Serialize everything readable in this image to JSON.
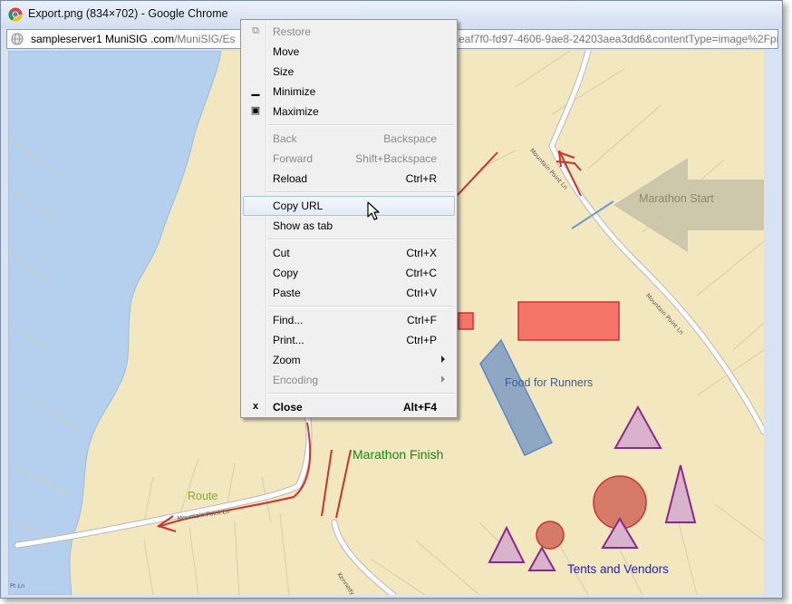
{
  "window": {
    "title": "Export.png (834×702) - Google Chrome",
    "icon": "chrome-icon"
  },
  "address_bar": {
    "icon": "globe-icon",
    "url_host_1": "sampleserver1",
    "url_host_2": "MuniSIG",
    "url_host_3": ".com",
    "url_path_start": "/MuniSIG/Es",
    "url_path_end": "eaf7f0-fd97-4606-9ae8-24203aea3dd6&contentType=image%2Fpm"
  },
  "map": {
    "labels": {
      "marathon_start": "Marathon Start",
      "food_for_runners": "Food for Runners",
      "marathon_finish": "Marathon Finish",
      "route": "Route",
      "tents_and_vendors": "Tents and Vendors"
    },
    "road_labels": {
      "mountain_point_ln_upper": "Mountain Point Ln",
      "mountain_point_ln_right": "Mountain Point Ln",
      "mountain_point_ln_lower": "Mountain Point Ln",
      "kennedy_rd": "Kennedy Rd",
      "pt_ln": "Pt Ln"
    },
    "colors": {
      "land": "#f2e7bf",
      "water": "#b4d0ee",
      "route": "#cc3333",
      "arrow": "#b8b29a",
      "food_area": "#8aa3c4",
      "tent": "#d9b3cc",
      "tent_outline": "#8a2a8a",
      "vendor_area": "#f47468"
    }
  },
  "context_menu": {
    "items": [
      {
        "label": "Restore",
        "shortcut": "",
        "disabled": true,
        "icon": "restore-icon"
      },
      {
        "label": "Move",
        "shortcut": "",
        "disabled": false,
        "icon": ""
      },
      {
        "label": "Size",
        "shortcut": "",
        "disabled": false,
        "icon": ""
      },
      {
        "label": "Minimize",
        "shortcut": "",
        "disabled": false,
        "icon": "minimize-icon"
      },
      {
        "label": "Maximize",
        "shortcut": "",
        "disabled": false,
        "icon": "maximize-icon"
      },
      {
        "label": "Back",
        "shortcut": "Backspace",
        "disabled": true,
        "icon": ""
      },
      {
        "label": "Forward",
        "shortcut": "Shift+Backspace",
        "disabled": true,
        "icon": ""
      },
      {
        "label": "Reload",
        "shortcut": "Ctrl+R",
        "disabled": false,
        "icon": ""
      },
      {
        "label": "Copy URL",
        "shortcut": "",
        "disabled": false,
        "icon": "",
        "highlighted": true
      },
      {
        "label": "Show as tab",
        "shortcut": "",
        "disabled": false,
        "icon": ""
      },
      {
        "label": "Cut",
        "shortcut": "Ctrl+X",
        "disabled": false,
        "icon": ""
      },
      {
        "label": "Copy",
        "shortcut": "Ctrl+C",
        "disabled": false,
        "icon": ""
      },
      {
        "label": "Paste",
        "shortcut": "Ctrl+V",
        "disabled": false,
        "icon": ""
      },
      {
        "label": "Find...",
        "shortcut": "Ctrl+F",
        "disabled": false,
        "icon": ""
      },
      {
        "label": "Print...",
        "shortcut": "Ctrl+P",
        "disabled": false,
        "icon": ""
      },
      {
        "label": "Zoom",
        "shortcut": "",
        "disabled": false,
        "icon": "",
        "submenu": true
      },
      {
        "label": "Encoding",
        "shortcut": "",
        "disabled": true,
        "icon": "",
        "submenu": true
      },
      {
        "label": "Close",
        "shortcut": "Alt+F4",
        "disabled": false,
        "icon": "close-icon",
        "bold": true
      }
    ]
  }
}
